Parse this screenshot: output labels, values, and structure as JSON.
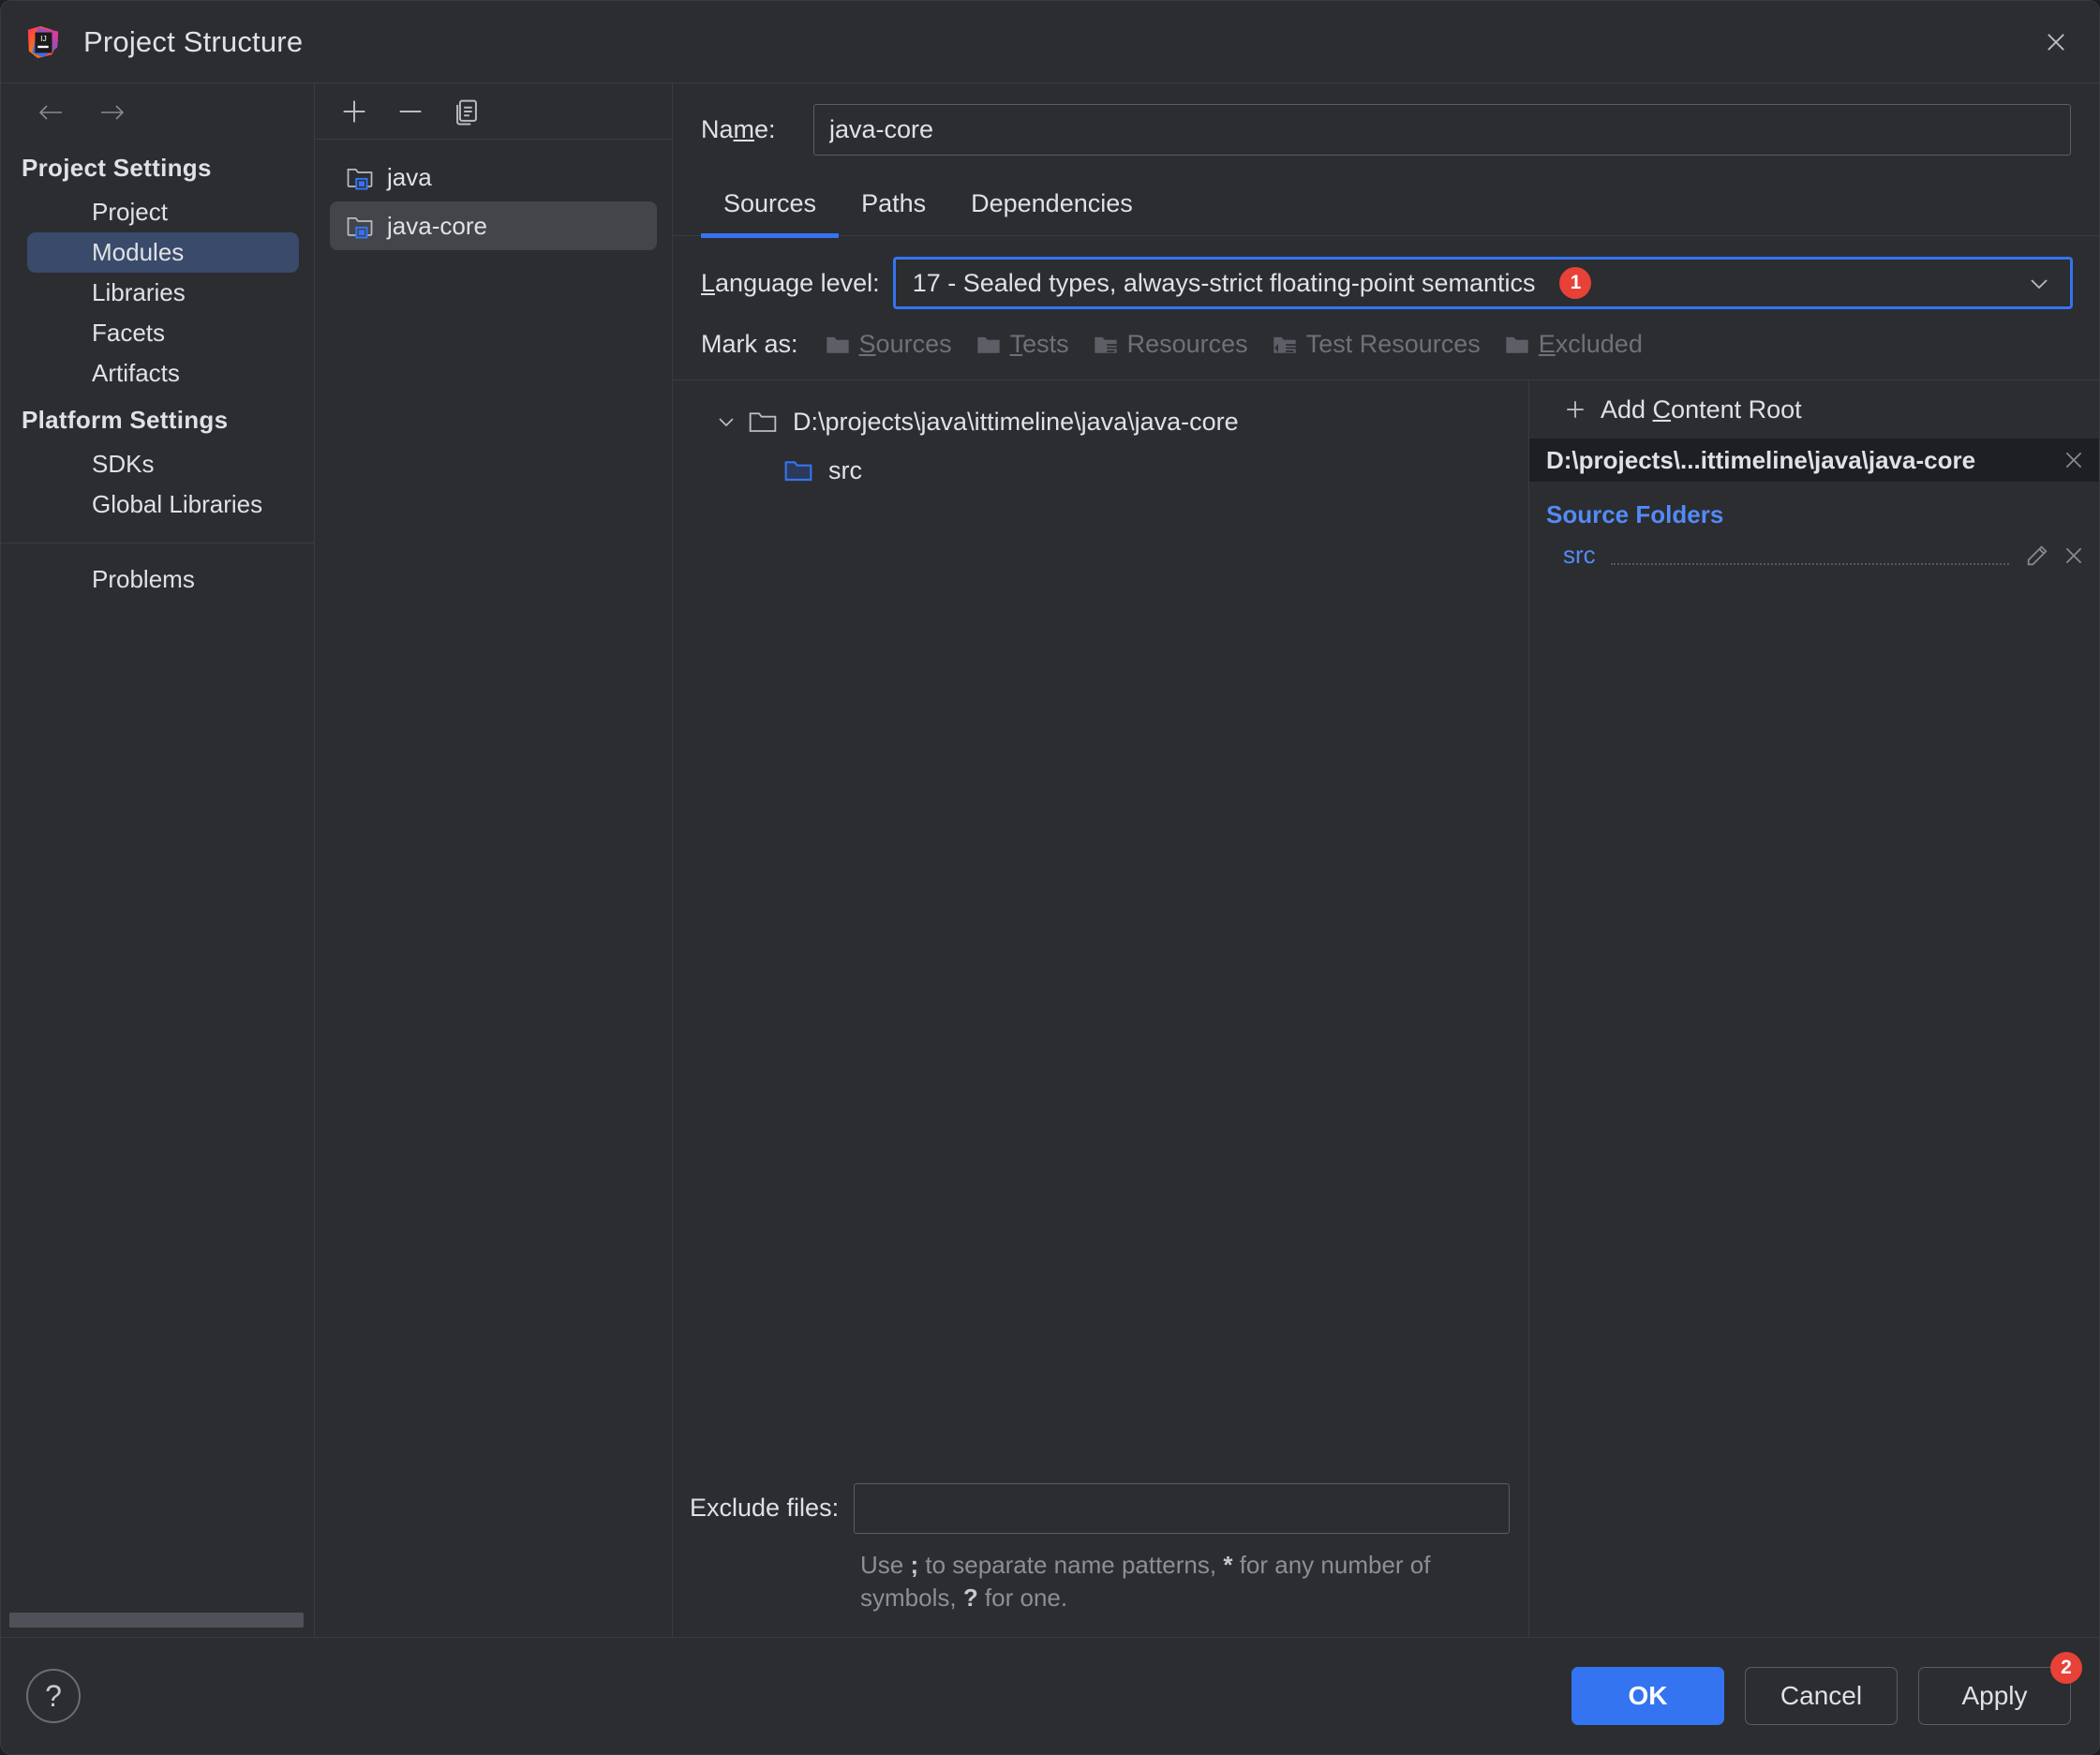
{
  "window": {
    "title": "Project Structure",
    "logo_icon": "intellij-idea-logo",
    "close_icon": "close-icon"
  },
  "sidebar": {
    "back_icon": "arrow-left-icon",
    "forward_icon": "arrow-right-icon",
    "groups": [
      {
        "label": "Project Settings",
        "items": [
          {
            "label": "Project",
            "selected": false
          },
          {
            "label": "Modules",
            "selected": true
          },
          {
            "label": "Libraries",
            "selected": false
          },
          {
            "label": "Facets",
            "selected": false
          },
          {
            "label": "Artifacts",
            "selected": false
          }
        ]
      },
      {
        "label": "Platform Settings",
        "items": [
          {
            "label": "SDKs",
            "selected": false
          },
          {
            "label": "Global Libraries",
            "selected": false
          }
        ]
      }
    ],
    "problems_label": "Problems"
  },
  "modules_panel": {
    "toolbar": {
      "add_icon": "plus-icon",
      "remove_icon": "minus-icon",
      "copy_icon": "copy-icon"
    },
    "items": [
      {
        "label": "java",
        "icon": "module-folder-icon",
        "selected": false
      },
      {
        "label": "java-core",
        "icon": "module-folder-icon",
        "selected": true
      }
    ]
  },
  "main": {
    "name": {
      "label": "Name:",
      "label_mnemonic": "m",
      "value": "java-core"
    },
    "tabs": [
      {
        "label": "Sources",
        "active": true
      },
      {
        "label": "Paths",
        "active": false
      },
      {
        "label": "Dependencies",
        "active": false
      }
    ],
    "language_level": {
      "label": "Language level:",
      "label_mnemonic": "L",
      "value": "17 - Sealed types, always-strict floating-point semantics",
      "badge": "1",
      "badge_color": "#e74138",
      "focus_border_color": "#3574f0",
      "chevron_icon": "chevron-down-icon"
    },
    "mark_as": {
      "label": "Mark as:",
      "options": [
        {
          "label": "Sources",
          "mnemonic": "S",
          "icon": "folder-sources-icon",
          "enabled": false
        },
        {
          "label": "Tests",
          "mnemonic": "T",
          "icon": "folder-tests-icon",
          "enabled": false
        },
        {
          "label": "Resources",
          "mnemonic": "",
          "icon": "folder-resources-icon",
          "enabled": false
        },
        {
          "label": "Test Resources",
          "mnemonic": "",
          "icon": "folder-test-resources-icon",
          "enabled": false
        },
        {
          "label": "Excluded",
          "mnemonic": "E",
          "icon": "folder-excluded-icon",
          "enabled": false
        }
      ]
    },
    "tree": [
      {
        "label": "D:\\projects\\java\\ittimeline\\java\\java-core",
        "level": 0,
        "expanded": true,
        "icon": "folder-icon"
      },
      {
        "label": "src",
        "level": 1,
        "expanded": false,
        "icon": "source-folder-icon"
      }
    ],
    "exclude": {
      "label": "Exclude files:",
      "value": "",
      "placeholder": "",
      "hint_parts": [
        "Use ",
        ";",
        " to separate name patterns, ",
        "*",
        " for any number of symbols, ",
        "?",
        " for one."
      ]
    }
  },
  "right_pane": {
    "add_content_root": {
      "label": "Add Content Root",
      "mnemonic": "C",
      "icon": "plus-icon"
    },
    "content_root": {
      "path": "D:\\projects\\...ittimeline\\java\\java-core",
      "remove_icon": "close-icon"
    },
    "source_folders": {
      "title": "Source Folders",
      "items": [
        {
          "name": "src",
          "edit_icon": "pencil-icon",
          "remove_icon": "close-icon"
        }
      ]
    }
  },
  "footer": {
    "help_label": "?",
    "buttons": [
      {
        "label": "OK",
        "primary": true,
        "badge": null
      },
      {
        "label": "Cancel",
        "primary": false,
        "badge": null
      },
      {
        "label": "Apply",
        "primary": false,
        "badge": "2"
      }
    ]
  }
}
